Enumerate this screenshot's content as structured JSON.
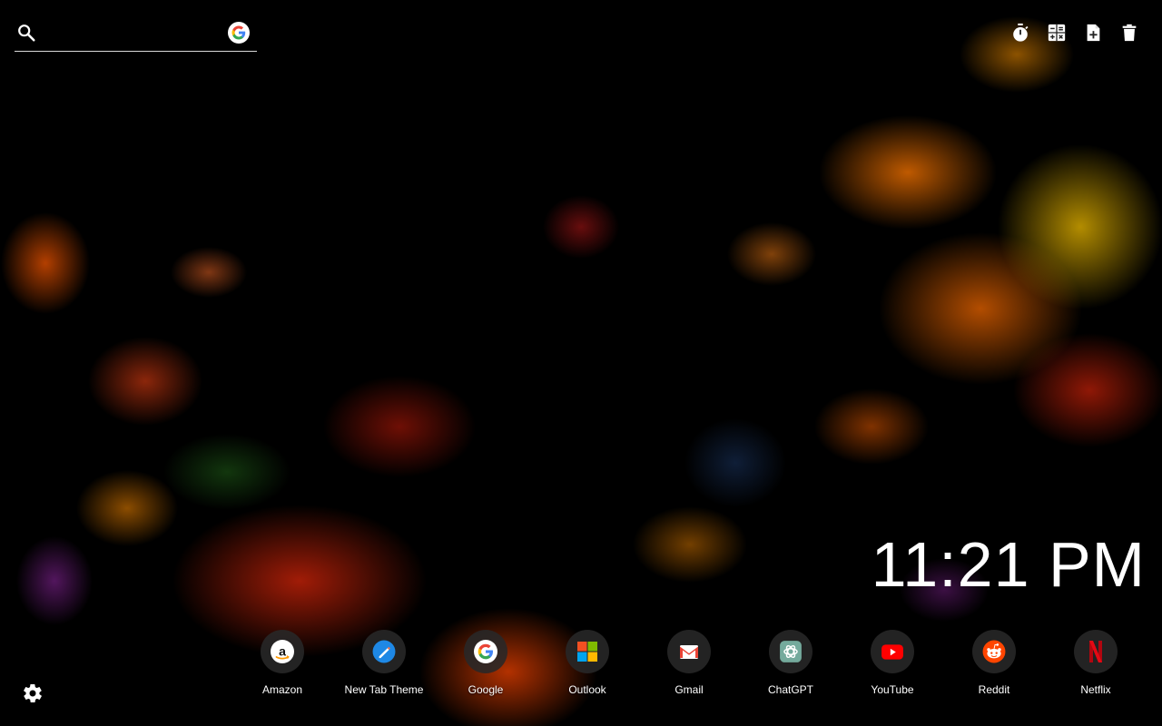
{
  "search": {
    "placeholder": "",
    "engine_icon": "google-icon"
  },
  "toolbar": {
    "items": [
      {
        "icon": "stopwatch-icon"
      },
      {
        "icon": "calculator-icon"
      },
      {
        "icon": "add-note-icon"
      },
      {
        "icon": "trash-icon"
      }
    ]
  },
  "clock": {
    "time": "11:21 PM"
  },
  "shortcuts": [
    {
      "label": "Amazon",
      "icon": "amazon-icon"
    },
    {
      "label": "New Tab Theme",
      "icon": "new-tab-theme-icon"
    },
    {
      "label": "Google",
      "icon": "google-icon"
    },
    {
      "label": "Outlook",
      "icon": "microsoft-icon"
    },
    {
      "label": "Gmail",
      "icon": "gmail-icon"
    },
    {
      "label": "ChatGPT",
      "icon": "chatgpt-icon"
    },
    {
      "label": "YouTube",
      "icon": "youtube-icon"
    },
    {
      "label": "Reddit",
      "icon": "reddit-icon"
    },
    {
      "label": "Netflix",
      "icon": "netflix-icon"
    }
  ],
  "settings": {
    "icon": "gear-icon"
  }
}
